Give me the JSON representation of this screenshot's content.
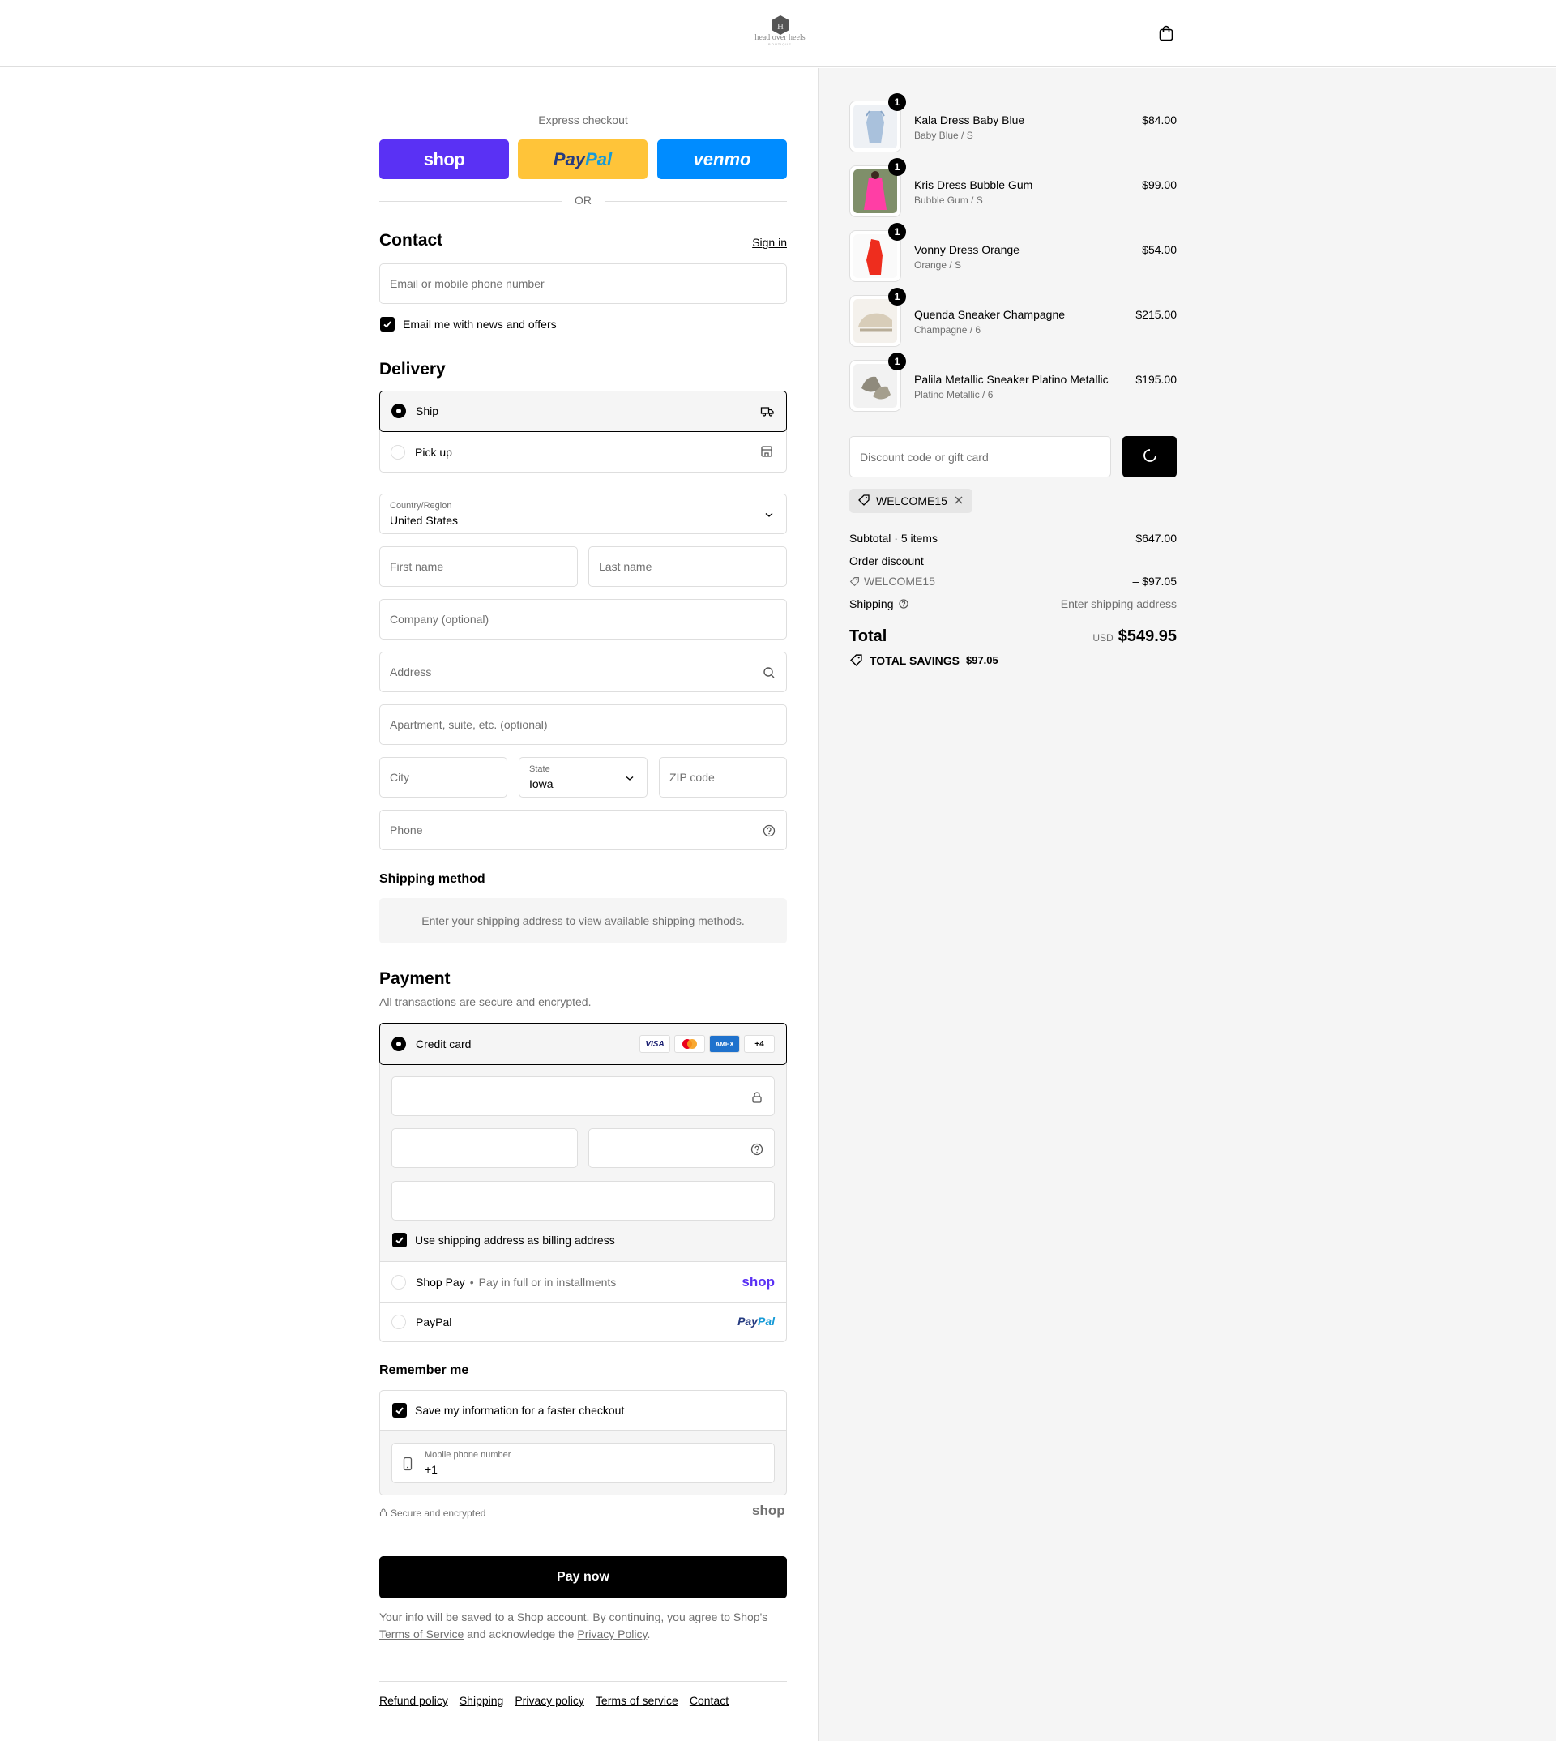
{
  "brand": {
    "logo_text": "head over heels",
    "logo_sub": "BOUTIQUE"
  },
  "express": {
    "label": "Express checkout",
    "shop": "shop",
    "paypal_a": "Pay",
    "paypal_b": "Pal",
    "venmo": "venmo",
    "or": "OR"
  },
  "contact": {
    "title": "Contact",
    "sign_in": "Sign in",
    "email_placeholder": "Email or mobile phone number",
    "news_label": "Email me with news and offers"
  },
  "delivery": {
    "title": "Delivery",
    "ship": "Ship",
    "pickup": "Pick up",
    "country_label": "Country/Region",
    "country_value": "United States",
    "first_name": "First name",
    "last_name": "Last name",
    "company": "Company (optional)",
    "address": "Address",
    "apartment": "Apartment, suite, etc. (optional)",
    "city": "City",
    "state_label": "State",
    "state_value": "Iowa",
    "zip": "ZIP code",
    "phone": "Phone"
  },
  "shipping_method": {
    "title": "Shipping method",
    "info": "Enter your shipping address to view available shipping methods."
  },
  "payment": {
    "title": "Payment",
    "subtitle": "All transactions are secure and encrypted.",
    "credit_card": "Credit card",
    "cards": [
      "VISA",
      "MC",
      "AMEX",
      "+4"
    ],
    "billing_label": "Use shipping address as billing address",
    "shop_pay": "Shop Pay",
    "shop_pay_dot": "•",
    "shop_pay_sub": "Pay in full or in installments",
    "shop_pay_logo": "shop",
    "paypal": "PayPal",
    "paypal_logo_a": "Pay",
    "paypal_logo_b": "Pal"
  },
  "remember": {
    "title": "Remember me",
    "save_label": "Save my information for a faster checkout",
    "mobile_label": "Mobile phone number",
    "mobile_value": "+1",
    "secure": "Secure and encrypted",
    "shop_logo": "shop"
  },
  "pay_now": "Pay now",
  "legal": {
    "part1": "Your info will be saved to a Shop account. By continuing, you agree to Shop's",
    "terms": "Terms of Service",
    "part2": "and acknowledge the",
    "privacy": "Privacy Policy",
    "part3": "."
  },
  "footer": [
    "Refund policy",
    "Shipping",
    "Privacy policy",
    "Terms of service",
    "Contact"
  ],
  "cart": {
    "items": [
      {
        "name": "Kala Dress Baby Blue",
        "variant": "Baby Blue / S",
        "price": "$84.00",
        "qty": "1"
      },
      {
        "name": "Kris Dress Bubble Gum",
        "variant": "Bubble Gum / S",
        "price": "$99.00",
        "qty": "1"
      },
      {
        "name": "Vonny Dress Orange",
        "variant": "Orange / S",
        "price": "$54.00",
        "qty": "1"
      },
      {
        "name": "Quenda Sneaker Champagne",
        "variant": "Champagne / 6",
        "price": "$215.00",
        "qty": "1"
      },
      {
        "name": "Palila Metallic Sneaker Platino Metallic",
        "variant": "Platino Metallic / 6",
        "price": "$195.00",
        "qty": "1"
      }
    ],
    "discount_placeholder": "Discount code or gift card",
    "applied_code": "WELCOME15",
    "subtotal_label": "Subtotal · 5 items",
    "subtotal_value": "$647.00",
    "order_discount_label": "Order discount",
    "discount_code": "WELCOME15",
    "discount_value": "– $97.05",
    "shipping_label": "Shipping",
    "shipping_value": "Enter shipping address",
    "total_label": "Total",
    "currency": "USD",
    "total_value": "$549.95",
    "savings_label": "TOTAL SAVINGS",
    "savings_value": "$97.05"
  },
  "colors": {
    "shop": "#5a31f4",
    "paypal": "#ffc439",
    "venmo": "#008cff",
    "accent": "#000000"
  }
}
